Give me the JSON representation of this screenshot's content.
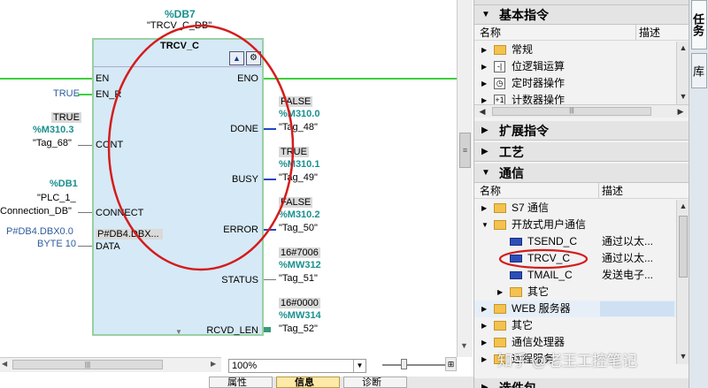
{
  "block": {
    "db": "%DB7",
    "instance": "\"TRCV_C_DB\"",
    "type": "TRCV_C",
    "inputs": {
      "en": "EN",
      "en_r": "EN_R",
      "cont": "CONT",
      "connect": "CONNECT",
      "data": "DATA"
    },
    "outputs": {
      "eno": "ENO",
      "done": "DONE",
      "busy": "BUSY",
      "error": "ERROR",
      "status": "STATUS",
      "rcvd_len": "RCVD_LEN"
    }
  },
  "params": {
    "en_r": {
      "value": "TRUE"
    },
    "cont": {
      "live": "TRUE",
      "addr": "%M310.3",
      "tag": "\"Tag_68\""
    },
    "connect": {
      "addr": "%DB1",
      "tag1": "\"PLC_1_",
      "tag2": "Connection_DB\""
    },
    "data": {
      "addr": "P#DB4.DBX0.0",
      "type": "BYTE 10",
      "boxed": "P#DB4.DBX..."
    },
    "done": {
      "live": "FALSE",
      "addr": "%M310.0",
      "tag": "\"Tag_48\""
    },
    "busy": {
      "live": "TRUE",
      "addr": "%M310.1",
      "tag": "\"Tag_49\""
    },
    "error": {
      "live": "FALSE",
      "addr": "%M310.2",
      "tag": "\"Tag_50\""
    },
    "status": {
      "live": "16#7006",
      "addr": "%MW312",
      "tag": "\"Tag_51\""
    },
    "rcvd_len": {
      "live": "16#0000",
      "addr": "%MW314",
      "tag": "\"Tag_52\""
    }
  },
  "editor": {
    "zoom": "100%",
    "bottom_tabs": [
      "属性",
      "信息",
      "诊断"
    ]
  },
  "tasks": {
    "sections": {
      "basic": "基本指令",
      "extended": "扩展指令",
      "technology": "工艺",
      "communication": "通信",
      "optional": "选件包"
    },
    "columns": {
      "name": "名称",
      "desc": "描述"
    },
    "basic_items": [
      "常规",
      "位逻辑运算",
      "定时器操作",
      "计数器操作"
    ],
    "comm_items": {
      "s7": "S7 通信",
      "open_user": "开放式用户通信",
      "tsend": "TSEND_C",
      "tsend_desc": "通过以太...",
      "trcv": "TRCV_C",
      "trcv_desc": "通过以太...",
      "tmail": "TMAIL_C",
      "tmail_desc": "发送电子...",
      "other_sub": "其它",
      "web": "WEB 服务器",
      "other": "其它",
      "cp": "通信处理器",
      "remote": "远程服务"
    },
    "side_tabs": [
      "任务",
      "库"
    ]
  },
  "watermark": "知乎 @老王工控笔记",
  "colors": {
    "rung": "#3ed03e",
    "block_fill": "#d6e9f6",
    "block_border": "#98d0a4",
    "address": "#1a8f8f",
    "highlight_ring": "#d41c1c",
    "selected_row": "#cfe0f3"
  }
}
